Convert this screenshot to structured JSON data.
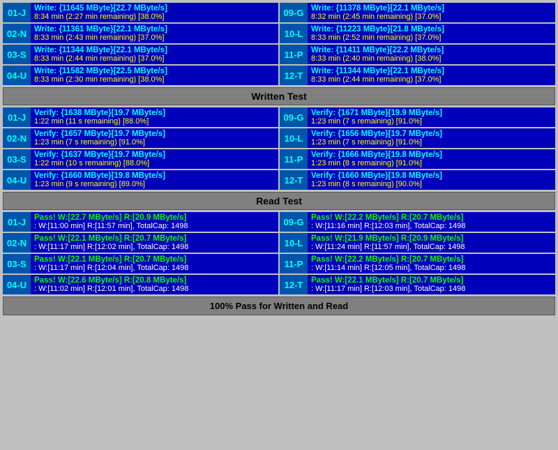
{
  "sections": {
    "write": {
      "label": "Written Test",
      "rows": [
        {
          "left": {
            "id": "01-J",
            "line1": "Write: {11645 MByte}[22.7 MByte/s]",
            "line2": "8:34 min (2:27 min remaining)  [38.0%]"
          },
          "right": {
            "id": "09-G",
            "line1": "Write: {11378 MByte}[22.1 MByte/s]",
            "line2": "8:32 min (2:45 min remaining)  [37.0%]"
          }
        },
        {
          "left": {
            "id": "02-N",
            "line1": "Write: {11361 MByte}[22.1 MByte/s]",
            "line2": "8:33 min (2:43 min remaining)  [37.0%]"
          },
          "right": {
            "id": "10-L",
            "line1": "Write: {11223 MByte}[21.8 MByte/s]",
            "line2": "8:33 min (2:52 min remaining)  [37.0%]"
          }
        },
        {
          "left": {
            "id": "03-S",
            "line1": "Write: {11344 MByte}[22.1 MByte/s]",
            "line2": "8:33 min (2:44 min remaining)  [37.0%]"
          },
          "right": {
            "id": "11-P",
            "line1": "Write: {11411 MByte}[22.2 MByte/s]",
            "line2": "8:33 min (2:40 min remaining)  [38.0%]"
          }
        },
        {
          "left": {
            "id": "04-U",
            "line1": "Write: {11582 MByte}[22.5 MByte/s]",
            "line2": "8:33 min (2:30 min remaining)  [38.0%]"
          },
          "right": {
            "id": "12-T",
            "line1": "Write: {11344 MByte}[22.1 MByte/s]",
            "line2": "8:33 min (2:44 min remaining)  [37.0%]"
          }
        }
      ]
    },
    "written_test_label": "Written Test",
    "verify": {
      "rows": [
        {
          "left": {
            "id": "01-J",
            "line1": "Verify: {1638 MByte}[19.7 MByte/s]",
            "line2": "1:22 min (11 s remaining)   [88.0%]"
          },
          "right": {
            "id": "09-G",
            "line1": "Verify: {1671 MByte}[19.9 MByte/s]",
            "line2": "1:23 min (7 s remaining)   [91.0%]"
          }
        },
        {
          "left": {
            "id": "02-N",
            "line1": "Verify: {1657 MByte}[19.7 MByte/s]",
            "line2": "1:23 min (7 s remaining)   [91.0%]"
          },
          "right": {
            "id": "10-L",
            "line1": "Verify: {1656 MByte}[19.7 MByte/s]",
            "line2": "1:23 min (7 s remaining)   [91.0%]"
          }
        },
        {
          "left": {
            "id": "03-S",
            "line1": "Verify: {1637 MByte}[19.7 MByte/s]",
            "line2": "1:22 min (10 s remaining)   [88.0%]"
          },
          "right": {
            "id": "11-P",
            "line1": "Verify: {1666 MByte}[19.8 MByte/s]",
            "line2": "1:23 min (8 s remaining)   [91.0%]"
          }
        },
        {
          "left": {
            "id": "04-U",
            "line1": "Verify: {1660 MByte}[19.8 MByte/s]",
            "line2": "1:23 min (9 s remaining)   [89.0%]"
          },
          "right": {
            "id": "12-T",
            "line1": "Verify: {1660 MByte}[19.8 MByte/s]",
            "line2": "1:23 min (8 s remaining)   [90.0%]"
          }
        }
      ]
    },
    "read_test_label": "Read Test",
    "pass": {
      "rows": [
        {
          "left": {
            "id": "01-J",
            "line1": "Pass! W:[22.7 MByte/s] R:[20.9 MByte/s]",
            "line2": ": W:[11:00 min] R:[11:57 min], TotalCap: 1498"
          },
          "right": {
            "id": "09-G",
            "line1": "Pass! W:[22.2 MByte/s] R:[20.7 MByte/s]",
            "line2": ": W:[11:16 min] R:[12:03 min], TotalCap: 1498"
          }
        },
        {
          "left": {
            "id": "02-N",
            "line1": "Pass! W:[22.1 MByte/s] R:[20.7 MByte/s]",
            "line2": ": W:[11:17 min] R:[12:02 min], TotalCap: 1498"
          },
          "right": {
            "id": "10-L",
            "line1": "Pass! W:[21.9 MByte/s] R:[20.9 MByte/s]",
            "line2": ": W:[11:24 min] R:[11:57 min], TotalCap: 1498"
          }
        },
        {
          "left": {
            "id": "03-S",
            "line1": "Pass! W:[22.1 MByte/s] R:[20.7 MByte/s]",
            "line2": ": W:[11:17 min] R:[12:04 min], TotalCap: 1498"
          },
          "right": {
            "id": "11-P",
            "line1": "Pass! W:[22.2 MByte/s] R:[20.7 MByte/s]",
            "line2": ": W:[11:14 min] R:[12:05 min], TotalCap: 1498"
          }
        },
        {
          "left": {
            "id": "04-U",
            "line1": "Pass! W:[22.6 MByte/s] R:[20.8 MByte/s]",
            "line2": ": W:[11:02 min] R:[12:01 min], TotalCap: 1498"
          },
          "right": {
            "id": "12-T",
            "line1": "Pass! W:[22.1 MByte/s] R:[20.7 MByte/s]",
            "line2": ": W:[11:17 min] R:[12:03 min], TotalCap: 1498"
          }
        }
      ]
    },
    "bottom_label": "100% Pass for Written and Read"
  }
}
